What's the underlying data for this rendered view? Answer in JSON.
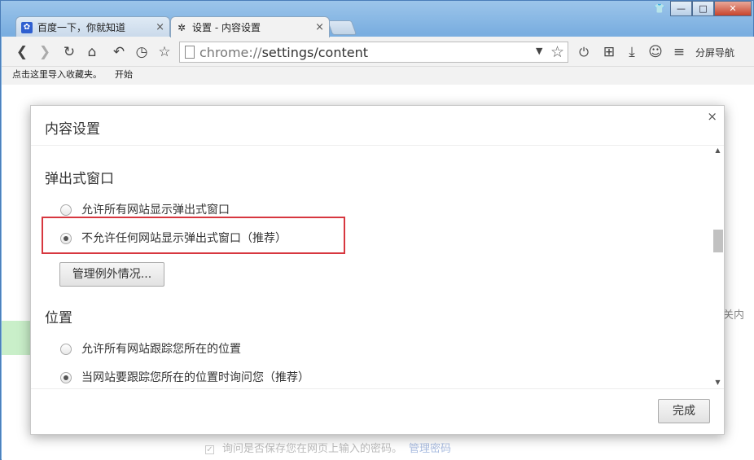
{
  "browser": {
    "tabs": [
      {
        "title": "百度一下，你就知道",
        "icon": "baidu-paw-icon",
        "close": "×"
      },
      {
        "title": "设置 - 内容设置",
        "icon": "gear-icon",
        "close": "×"
      }
    ],
    "window_controls": {
      "minimize": "—",
      "maximize": "□",
      "close": "✕"
    }
  },
  "toolbar": {
    "back": "❮",
    "forward": "❯",
    "reload": "↻",
    "home": "⌂",
    "undo": "↶",
    "history": "◷",
    "favorite": "☆",
    "url_scheme": "chrome://",
    "url_path": "settings/content",
    "dropdown": "▼",
    "bookmark_star": "☆",
    "power": "⏻",
    "apps": "⊞",
    "download": "⤓",
    "account": "☺",
    "menu": "≡",
    "split_nav_label": "分屏导航"
  },
  "bookmarks_bar": {
    "import_hint": "点击这里导入收藏夹。",
    "start_label": "开始"
  },
  "background_page": {
    "truncated_text": "关内",
    "footer_checkbox": "✓",
    "footer_text": "询问是否保存您在网页上输入的密码。",
    "footer_link": "管理密码"
  },
  "dialog": {
    "title": "内容设置",
    "close": "×",
    "sections": {
      "popups": {
        "title": "弹出式窗口",
        "option_allow": "允许所有网站显示弹出式窗口",
        "option_block": "不允许任何网站显示弹出式窗口（推荐）",
        "selected": "block",
        "manage_button": "管理例外情况..."
      },
      "location": {
        "title": "位置",
        "option_allow": "允许所有网站跟踪您所在的位置",
        "option_ask": "当网站要跟踪您所在的位置时询问您（推荐）",
        "selected": "ask"
      }
    },
    "done_button": "完成",
    "scroll_up": "▲",
    "scroll_down": "▼"
  },
  "colors": {
    "highlight_border": "#d7373f",
    "window_frame": "#7fb2e0"
  }
}
